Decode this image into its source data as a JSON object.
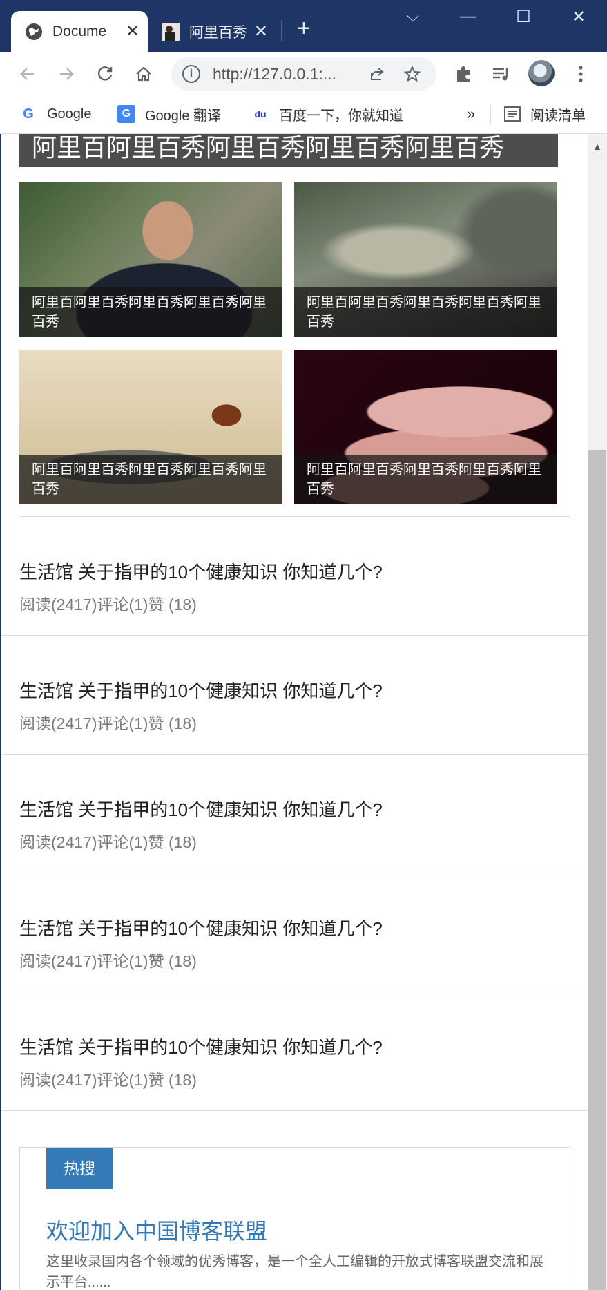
{
  "browser": {
    "tabs": [
      {
        "title": "Docume",
        "close": "✕"
      },
      {
        "title": "阿里百秀",
        "close": "✕"
      }
    ],
    "new_tab": "+",
    "window_controls": {
      "dropdown": "⌵",
      "minimize": "—",
      "maximize": "☐",
      "close": "✕"
    },
    "url": "http://127.0.0.1:...",
    "toolbar_icons": [
      "back-arrow-icon",
      "forward-arrow-icon",
      "reload-icon",
      "home-icon",
      "share-icon",
      "star-icon",
      "extensions-icon",
      "media-icon",
      "menu-icon"
    ],
    "bookmarks": [
      {
        "label": "Google",
        "icon": "G"
      },
      {
        "label": "Google 翻译",
        "icon": "G"
      },
      {
        "label": "百度一下，你就知道",
        "icon": "du"
      }
    ],
    "bookmarks_more": "»",
    "reading_list": "阅读清单"
  },
  "page": {
    "banner_title": "阿里百阿里百秀阿里百秀阿里百秀阿里百秀",
    "cards": [
      {
        "caption": "阿里百阿里百秀阿里百秀阿里百秀阿里百秀"
      },
      {
        "caption": "阿里百阿里百秀阿里百秀阿里百秀阿里百秀"
      },
      {
        "caption": "阿里百阿里百秀阿里百秀阿里百秀阿里百秀"
      },
      {
        "caption": "阿里百阿里百秀阿里百秀阿里百秀阿里百秀"
      }
    ],
    "articles": [
      {
        "title": "生活馆 关于指甲的10个健康知识 你知道几个?",
        "meta": "阅读(2417)评论(1)赞 (18)"
      },
      {
        "title": "生活馆 关于指甲的10个健康知识 你知道几个?",
        "meta": "阅读(2417)评论(1)赞 (18)"
      },
      {
        "title": "生活馆 关于指甲的10个健康知识 你知道几个?",
        "meta": "阅读(2417)评论(1)赞 (18)"
      },
      {
        "title": "生活馆 关于指甲的10个健康知识 你知道几个?",
        "meta": "阅读(2417)评论(1)赞 (18)"
      },
      {
        "title": "生活馆 关于指甲的10个健康知识 你知道几个?",
        "meta": "阅读(2417)评论(1)赞 (18)"
      }
    ],
    "hot": {
      "tab": "热搜",
      "link": "欢迎加入中国博客联盟",
      "desc": "这里收录国内各个领域的优秀博客，是一个全人工编辑的开放式博客联盟交流和展示平台......"
    }
  },
  "colors": {
    "titlebar": "#1e3566",
    "accent": "#337ab7",
    "banner": "#4d4d4d"
  }
}
